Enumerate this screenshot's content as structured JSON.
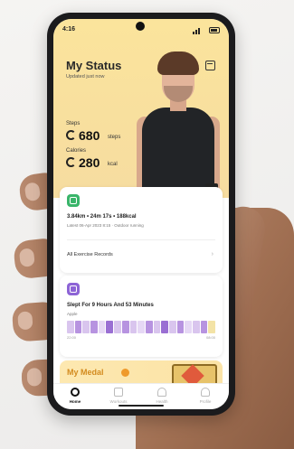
{
  "status_bar": {
    "time": "4:16"
  },
  "header": {
    "title": "My Status",
    "subtitle": "Updated just now",
    "calendar_icon": "calendar-icon"
  },
  "stats": {
    "steps": {
      "label": "Steps",
      "value": "680",
      "unit": "steps"
    },
    "calories": {
      "label": "Calories",
      "value": "280",
      "unit": "kcal"
    }
  },
  "workout_card": {
    "icon": "running-icon",
    "title": "3.84km • 24m 17s • 188kcal",
    "subtitle": "Latest 06-Apr 2023 8:15 · Outdoor running",
    "link": "All Exercise Records",
    "accent": "#39b56a"
  },
  "sleep_card": {
    "icon": "sleep-icon",
    "title": "Slept For 9 Hours And 53 Minutes",
    "subtitle": "Apple",
    "start": "22:00",
    "end": "08:00",
    "segments": [
      "#d9c5ee",
      "#b793e0",
      "#d9c5ee",
      "#b793e0",
      "#e6d8f5",
      "#9a6fd3",
      "#d9c5ee",
      "#b793e0",
      "#d9c5ee",
      "#e6d8f5",
      "#b793e0",
      "#d9c5ee",
      "#9a6fd3",
      "#d9c5ee",
      "#b793e0",
      "#e6d8f5",
      "#d9c5ee",
      "#b793e0",
      "#f3e3a6"
    ],
    "accent": "#8d64d6"
  },
  "medal_section": {
    "title": "My Medal"
  },
  "tabbar": {
    "items": [
      {
        "label": "Home",
        "icon": "home-icon"
      },
      {
        "label": "Workouts",
        "icon": "dumbbell-icon"
      },
      {
        "label": "Health",
        "icon": "heart-icon"
      },
      {
        "label": "Profile",
        "icon": "profile-icon"
      }
    ],
    "active": 0
  }
}
